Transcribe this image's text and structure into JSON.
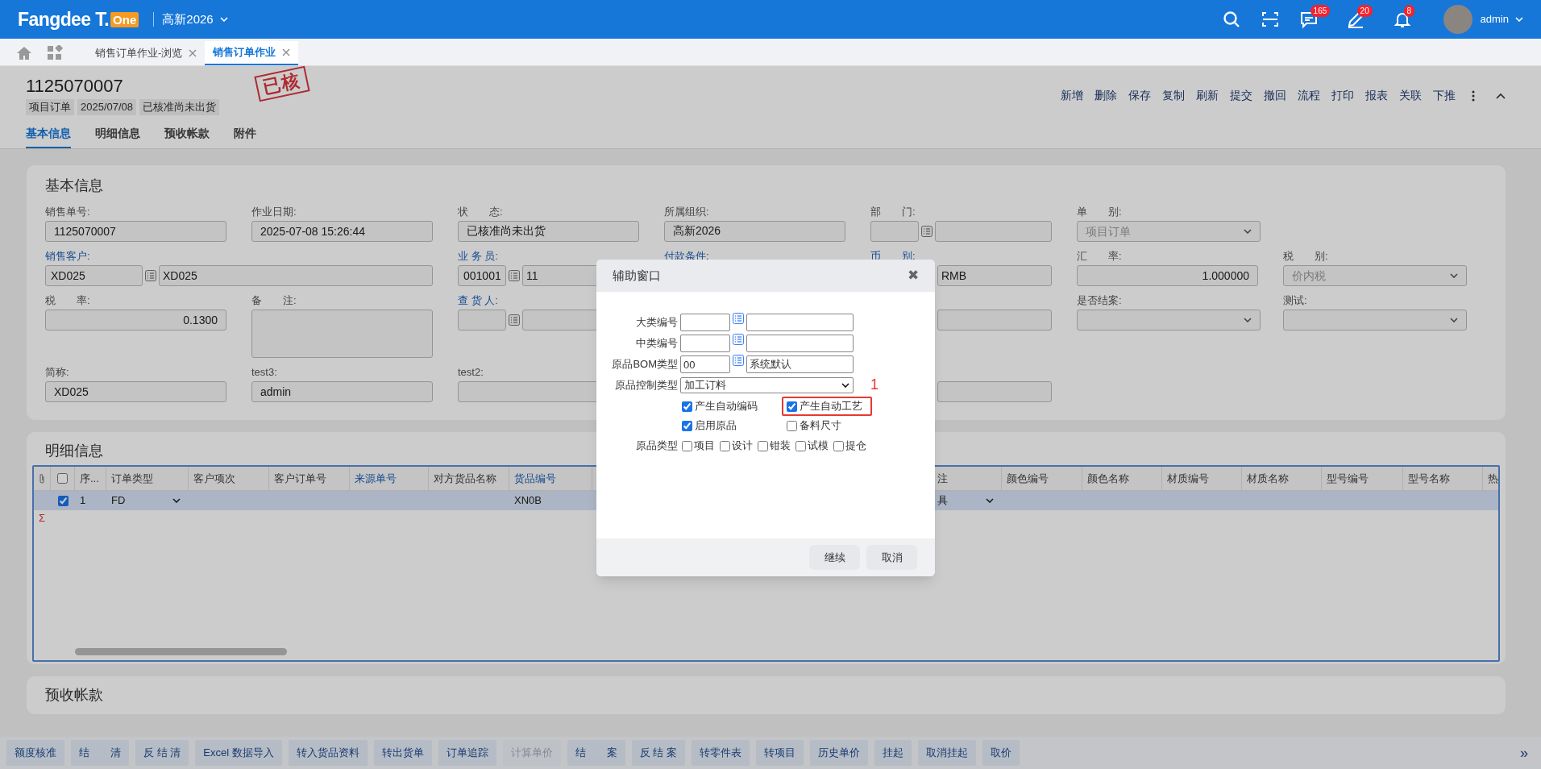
{
  "header": {
    "logo_text": "Fangdee T.",
    "logo_badge": "One",
    "org": "高新2026",
    "notifications": [
      {
        "kind": "search"
      },
      {
        "kind": "scan"
      },
      {
        "kind": "message",
        "count": "165"
      },
      {
        "kind": "pen",
        "count": "20"
      },
      {
        "kind": "bell",
        "count": "8"
      }
    ],
    "user": "admin"
  },
  "page_tabs": [
    {
      "label": "销售订单作业-浏览",
      "selected": false
    },
    {
      "label": "销售订单作业",
      "selected": true
    }
  ],
  "document": {
    "number": "1125070007",
    "tags": [
      "项目订单",
      "2025/07/08",
      "已核准尚未出货"
    ],
    "stamp": "已核",
    "actions": [
      "新增",
      "删除",
      "保存",
      "复制",
      "刷新",
      "提交",
      "撤回",
      "流程",
      "打印",
      "报表",
      "关联",
      "下推"
    ],
    "tabs": [
      {
        "label": "基本信息",
        "selected": true
      },
      {
        "label": "明细信息",
        "selected": false
      },
      {
        "label": "预收帐款",
        "selected": false
      },
      {
        "label": "附件",
        "selected": false
      }
    ]
  },
  "basic_info": {
    "title": "基本信息",
    "rows": [
      [
        {
          "label": "销售单号:",
          "kind": "text",
          "value": "1125070007"
        },
        {
          "label": "作业日期:",
          "kind": "text",
          "value": "2025-07-08 15:26:44"
        },
        {
          "label": "状　　态:",
          "kind": "text",
          "value": "已核准尚未出货"
        },
        {
          "label": "所属组织:",
          "kind": "text",
          "value": "高新2026"
        },
        {
          "label": "部　　门:",
          "kind": "lookup"
        },
        {
          "label": "单　　别:",
          "kind": "select",
          "value": "项目订单",
          "disabled": true
        }
      ],
      [
        {
          "label": "销售客户:",
          "kind": "lookup",
          "link": true,
          "code": "XD025",
          "value": "XD025"
        },
        "",
        {
          "label": "业 务 员:",
          "kind": "lookup",
          "link": true,
          "code": "001001",
          "value": "11"
        },
        {
          "label": "付款条件:",
          "kind": "covered",
          "link": true
        },
        {
          "label": "币　　别:",
          "kind": "partial",
          "link": true,
          "value": "RMB"
        },
        {
          "label": "汇　　率:",
          "kind": "number",
          "value": "1.000000"
        },
        {
          "label": "税　　别:",
          "kind": "select",
          "value": "价内税",
          "disabled": true
        }
      ],
      [
        {
          "label": "税　　率:",
          "kind": "number",
          "value": "0.1300"
        },
        {
          "label": "备　　注:",
          "kind": "textarea"
        },
        {
          "label": "查 货 人:",
          "kind": "lookup",
          "link": true
        },
        {
          "kind": "covered"
        },
        {
          "kind": "partial"
        },
        {
          "label": "是否结案:",
          "kind": "select"
        },
        {
          "label": "测试:",
          "kind": "select"
        }
      ],
      [
        {
          "label": "简称:",
          "kind": "text",
          "value": "XD025"
        },
        {
          "label": "test3:",
          "kind": "text",
          "value": "admin"
        },
        {
          "label": "test2:",
          "kind": "text"
        },
        {
          "kind": "covered"
        },
        {
          "kind": "partial"
        }
      ]
    ]
  },
  "detail": {
    "title": "明细信息",
    "all_selected": false,
    "columns": [
      {
        "label": "序...",
        "link": false
      },
      {
        "label": "订单类型",
        "link": false
      },
      {
        "label": "客户项次",
        "link": false
      },
      {
        "label": "客户订单号",
        "link": false
      },
      {
        "label": "来源单号",
        "link": true
      },
      {
        "label": "对方货品名称",
        "link": false
      },
      {
        "label": "货品编号",
        "link": true
      },
      {
        "label": "注",
        "link": false
      },
      {
        "label": "颜色编号",
        "link": false
      },
      {
        "label": "颜色名称",
        "link": false
      },
      {
        "label": "材质编号",
        "link": false
      },
      {
        "label": "材质名称",
        "link": false
      },
      {
        "label": "型号编号",
        "link": false
      },
      {
        "label": "型号名称",
        "link": false
      },
      {
        "label": "热",
        "link": false
      }
    ],
    "rows": [
      {
        "selected": true,
        "cells": [
          "1",
          "FD",
          "",
          "",
          "",
          "",
          "XN0B",
          "具",
          "",
          "",
          "",
          "",
          "",
          "",
          ""
        ]
      }
    ],
    "sum_mark": "Σ"
  },
  "advance": {
    "title": "预收帐款"
  },
  "toolbar": [
    {
      "label": "额度核准",
      "disabled": false
    },
    {
      "label": "结　　清",
      "disabled": false
    },
    {
      "label": "反 结 清",
      "disabled": false
    },
    {
      "label": "Excel 数据导入",
      "disabled": false
    },
    {
      "label": "转入货品资料",
      "disabled": false
    },
    {
      "label": "转出货单",
      "disabled": false
    },
    {
      "label": "订单追踪",
      "disabled": false
    },
    {
      "label": "计算单价",
      "disabled": true
    },
    {
      "label": "结　　案",
      "disabled": false
    },
    {
      "label": "反 结 案",
      "disabled": false
    },
    {
      "label": "转零件表",
      "disabled": false
    },
    {
      "label": "转项目",
      "disabled": false
    },
    {
      "label": "历史单价",
      "disabled": false
    },
    {
      "label": "挂起",
      "disabled": false
    },
    {
      "label": "取消挂起",
      "disabled": false
    },
    {
      "label": "取价",
      "disabled": false
    }
  ],
  "toolbar_more": "»",
  "dialog": {
    "title": "辅助窗口",
    "close": "✖",
    "fields": [
      {
        "label": "大类编号",
        "kind": "lookup"
      },
      {
        "label": "中类编号",
        "kind": "lookup"
      },
      {
        "label": "原品BOM类型",
        "kind": "lookup",
        "code": "00",
        "value": "系统默认"
      },
      {
        "label": "原品控制类型",
        "kind": "select",
        "value": "加工订料"
      }
    ],
    "options": [
      {
        "label": "产生自动编码",
        "checked": true,
        "highlighted": false
      },
      {
        "label": "产生自动工艺",
        "checked": true,
        "highlighted": true
      },
      {
        "label": "启用原品",
        "checked": true,
        "highlighted": false
      },
      {
        "label": "备料尺寸",
        "checked": false,
        "highlighted": false
      }
    ],
    "annotation": "1",
    "type_label": "原品类型",
    "types": [
      {
        "label": "项目",
        "checked": false
      },
      {
        "label": "设计",
        "checked": false
      },
      {
        "label": "钳装",
        "checked": false
      },
      {
        "label": "试模",
        "checked": false
      },
      {
        "label": "提仓",
        "checked": false
      }
    ],
    "buttons": [
      "继续",
      "取消"
    ]
  }
}
